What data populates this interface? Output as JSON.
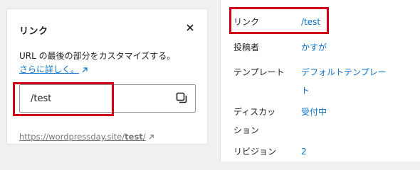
{
  "popover": {
    "title": "リンク",
    "description": "URL の最後の部分をカスタマイズする。",
    "learn_more": "さらに詳しく。",
    "slug_value": "/test",
    "permalink_prefix": "https://wordpressday.site/",
    "permalink_slug": "test",
    "permalink_suffix": "/"
  },
  "panel": {
    "rows": [
      {
        "label": "リンク",
        "value": "/test"
      },
      {
        "label": "投稿者",
        "value": "かすが"
      },
      {
        "label": "テンプレート",
        "value": "デフォルトテンプレー",
        "value_line2": "ト"
      },
      {
        "label": "ディスカッ",
        "label_line2": "ション",
        "value": "受付中"
      },
      {
        "label": "リビジョン",
        "value": "2"
      }
    ]
  },
  "colors": {
    "link": "#0a70c5",
    "highlight": "#d0021b",
    "muted": "#757575"
  },
  "icons": [
    "close-icon",
    "external-link-icon",
    "copy-icon"
  ]
}
